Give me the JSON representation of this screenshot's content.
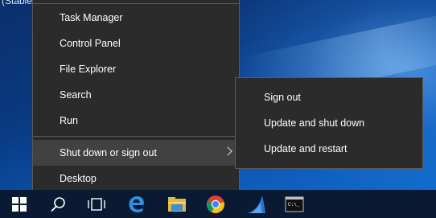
{
  "desktop": {
    "caption": "(Stable"
  },
  "context_menu": {
    "items": [
      {
        "label": "Task Manager"
      },
      {
        "label": "Control Panel"
      },
      {
        "label": "File Explorer"
      },
      {
        "label": "Search"
      },
      {
        "label": "Run"
      },
      {
        "label": "Shut down or sign out",
        "has_submenu": true,
        "highlighted": true
      },
      {
        "label": "Desktop"
      }
    ]
  },
  "submenu": {
    "items": [
      {
        "label": "Sign out"
      },
      {
        "label": "Update and shut down"
      },
      {
        "label": "Update and restart"
      }
    ]
  },
  "taskbar": {
    "icons": [
      "windows-start-icon",
      "search-icon",
      "task-view-icon",
      "edge-icon",
      "file-explorer-icon",
      "chrome-icon",
      "wireshark-icon",
      "command-prompt-icon"
    ]
  },
  "colors": {
    "menu_bg": "#2b2b2b",
    "menu_hover": "#414141",
    "menu_border": "#5a5a5a",
    "taskbar_bg": "#0b1a33"
  }
}
